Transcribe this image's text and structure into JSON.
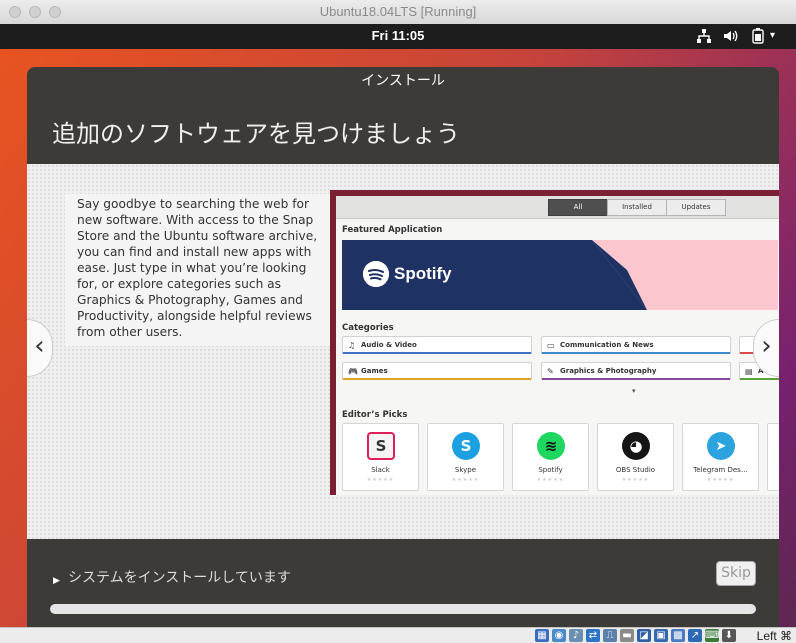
{
  "host": {
    "window_title": "Ubuntu18.04LTS [Running]",
    "host_key": "Left ⌘"
  },
  "ubuntu_bar": {
    "clock": "Fri 11:05"
  },
  "installer": {
    "header": "インストール",
    "title": "追加のソフトウェアを見つけましょう",
    "description": "Say goodbye to searching the web for new software. With access to the Snap Store and the Ubuntu software archive, you can find and install new apps with ease. Just type in what you’re looking for, or explore categories such as Graphics & Photography, Games and Productivity, alongside helpful reviews from other users.",
    "prev_glyph": "‹",
    "next_glyph": "›",
    "status_text": "システムをインストールしています",
    "skip_label": "Skip",
    "progress": 1.0
  },
  "software_center": {
    "tabs": [
      "All",
      "Installed",
      "Updates"
    ],
    "active_tab": "All",
    "featured_heading": "Featured Application",
    "featured_app": "Spotify",
    "categories_heading": "Categories",
    "categories": [
      {
        "label": "Audio & Video",
        "icon": "♫",
        "color": "#3b6fbf"
      },
      {
        "label": "Communication & News",
        "icon": "▭",
        "color": "#3b88c9"
      },
      {
        "label": "Games",
        "icon": "🎮",
        "color": "#e0a227"
      },
      {
        "label": "Graphics & Photography",
        "icon": "✎",
        "color": "#8a4a9b"
      },
      {
        "label": "A",
        "icon": "▤",
        "color": "#5aa336"
      }
    ],
    "picks_heading": "Editor’s Picks",
    "picks": [
      {
        "name": "Slack",
        "color": "#f4f4f4",
        "glyph": "S",
        "glyph_color": "#333"
      },
      {
        "name": "Skype",
        "color": "#1ba1e2",
        "glyph": "S",
        "glyph_color": "#ffffff"
      },
      {
        "name": "Spotify",
        "color": "#1ed760",
        "glyph": "≋",
        "glyph_color": "#111"
      },
      {
        "name": "OBS Studio",
        "color": "#151515",
        "glyph": "◕",
        "glyph_color": "#ffffff"
      },
      {
        "name": "Telegram Des…",
        "color": "#2aa3df",
        "glyph": "➤",
        "glyph_color": "#ffffff"
      }
    ],
    "stars": "★★★★★"
  }
}
